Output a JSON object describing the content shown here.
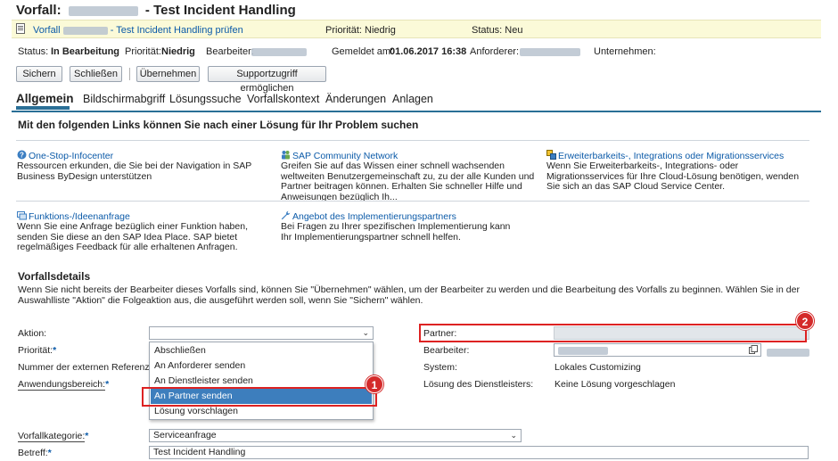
{
  "header": {
    "title_prefix": "Vorfall:",
    "title_suffix": "- Test Incident Handling"
  },
  "summary": {
    "link_prefix": "Vorfall",
    "link_suffix": "- Test Incident Handling prüfen",
    "priority": "Priorität: Niedrig",
    "status": "Status: Neu"
  },
  "status_row": {
    "status_label": "Status:",
    "status_value": "In Bearbeitung",
    "priority_label": "Priorität:",
    "priority_value": "Niedrig",
    "processor_label": "Bearbeiter:",
    "reported_label": "Gemeldet am:",
    "reported_value": "01.06.2017 16:38",
    "requester_label": "Anforderer:",
    "company_label": "Unternehmen:"
  },
  "toolbar": {
    "save": "Sichern",
    "close": "Schließen",
    "take_over": "Übernehmen",
    "support_access": "Supportzugriff ermöglichen"
  },
  "tabs": [
    "Allgemein",
    "Bildschirmabgriff",
    "Lösungssuche",
    "Vorfallskontext",
    "Änderungen",
    "Anlagen"
  ],
  "links_section": {
    "heading": "Mit den folgenden Links können Sie nach einer Lösung für Ihr Problem suchen",
    "items": [
      {
        "title": "One-Stop-Infocenter",
        "desc": "Ressourcen erkunden, die Sie bei der Navigation in SAP Business ByDesign unterstützen"
      },
      {
        "title": "SAP Community Network",
        "desc": "Greifen Sie auf das Wissen einer schnell wachsenden weltweiten Benutzergemeinschaft zu, zu der alle Kunden und Partner beitragen können. Erhalten Sie schneller Hilfe und Anweisungen bezüglich Ih..."
      },
      {
        "title": "Erweiterbarkeits-, Integrations oder Migrationsservices",
        "desc": "Wenn Sie Erweiterbarkeits-, Integrations- oder Migrationsservices für Ihre Cloud-Lösung benötigen, wenden Sie sich an das SAP Cloud Service Center."
      },
      {
        "title": "Funktions-/Ideenanfrage",
        "desc": "Wenn Sie eine Anfrage bezüglich einer Funktion haben, senden Sie diese an den SAP Idea Place. SAP bietet regelmäßiges Feedback für alle erhaltenen Anfragen."
      },
      {
        "title": "Angebot des Implementierungspartners",
        "desc": "Bei Fragen zu Ihrer spezifischen Implementierung kann Ihr Implementierungspartner schnell helfen."
      }
    ]
  },
  "details": {
    "heading": "Vorfallsdetails",
    "intro": "Wenn Sie nicht bereits der Bearbeiter dieses Vorfalls sind, können Sie \"Übernehmen\" wählen, um der Bearbeiter zu werden und die Bearbeitung des Vorfalls zu beginnen. Wählen Sie in der Auswahlliste \"Aktion\" die Folgeaktion aus, die ausgeführt werden soll, wenn Sie \"Sichern\" wählen.",
    "action_label": "Aktion:",
    "priority_label": "Priorität:",
    "ext_ref_label": "Nummer der externen Referenz:",
    "app_area_label": "Anwendungsbereich:",
    "category_label": "Vorfallkategorie:",
    "category_value": "Serviceanfrage",
    "subject_label": "Betreff:",
    "subject_value": "Test Incident Handling",
    "partner_label": "Partner:",
    "processor_label": "Bearbeiter:",
    "system_label": "System:",
    "system_value": "Lokales Customizing",
    "provider_solution_label": "Lösung des Dienstleisters:",
    "provider_solution_value": "Keine Lösung vorgeschlagen"
  },
  "action_options": [
    "Abschließen",
    "An Anforderer senden",
    "An Dienstleister senden",
    "An Partner senden",
    "Lösung vorschlagen"
  ],
  "markers": [
    "1",
    "2"
  ],
  "required_mark": "*",
  "chevron": "⌄"
}
